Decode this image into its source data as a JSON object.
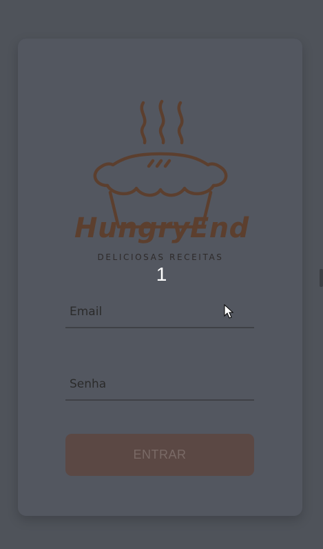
{
  "brand": {
    "name": "HungryEnd",
    "tagline": "DELICIOSAS RECEITAS",
    "logo_icon": "pie-icon",
    "color": "#5c3f2e"
  },
  "counter": "1",
  "form": {
    "email_placeholder": "Email",
    "password_placeholder": "Senha",
    "submit_label": "ENTRAR"
  },
  "colors": {
    "background": "#4f535a",
    "card": "#535760",
    "button": "#5b4844"
  }
}
